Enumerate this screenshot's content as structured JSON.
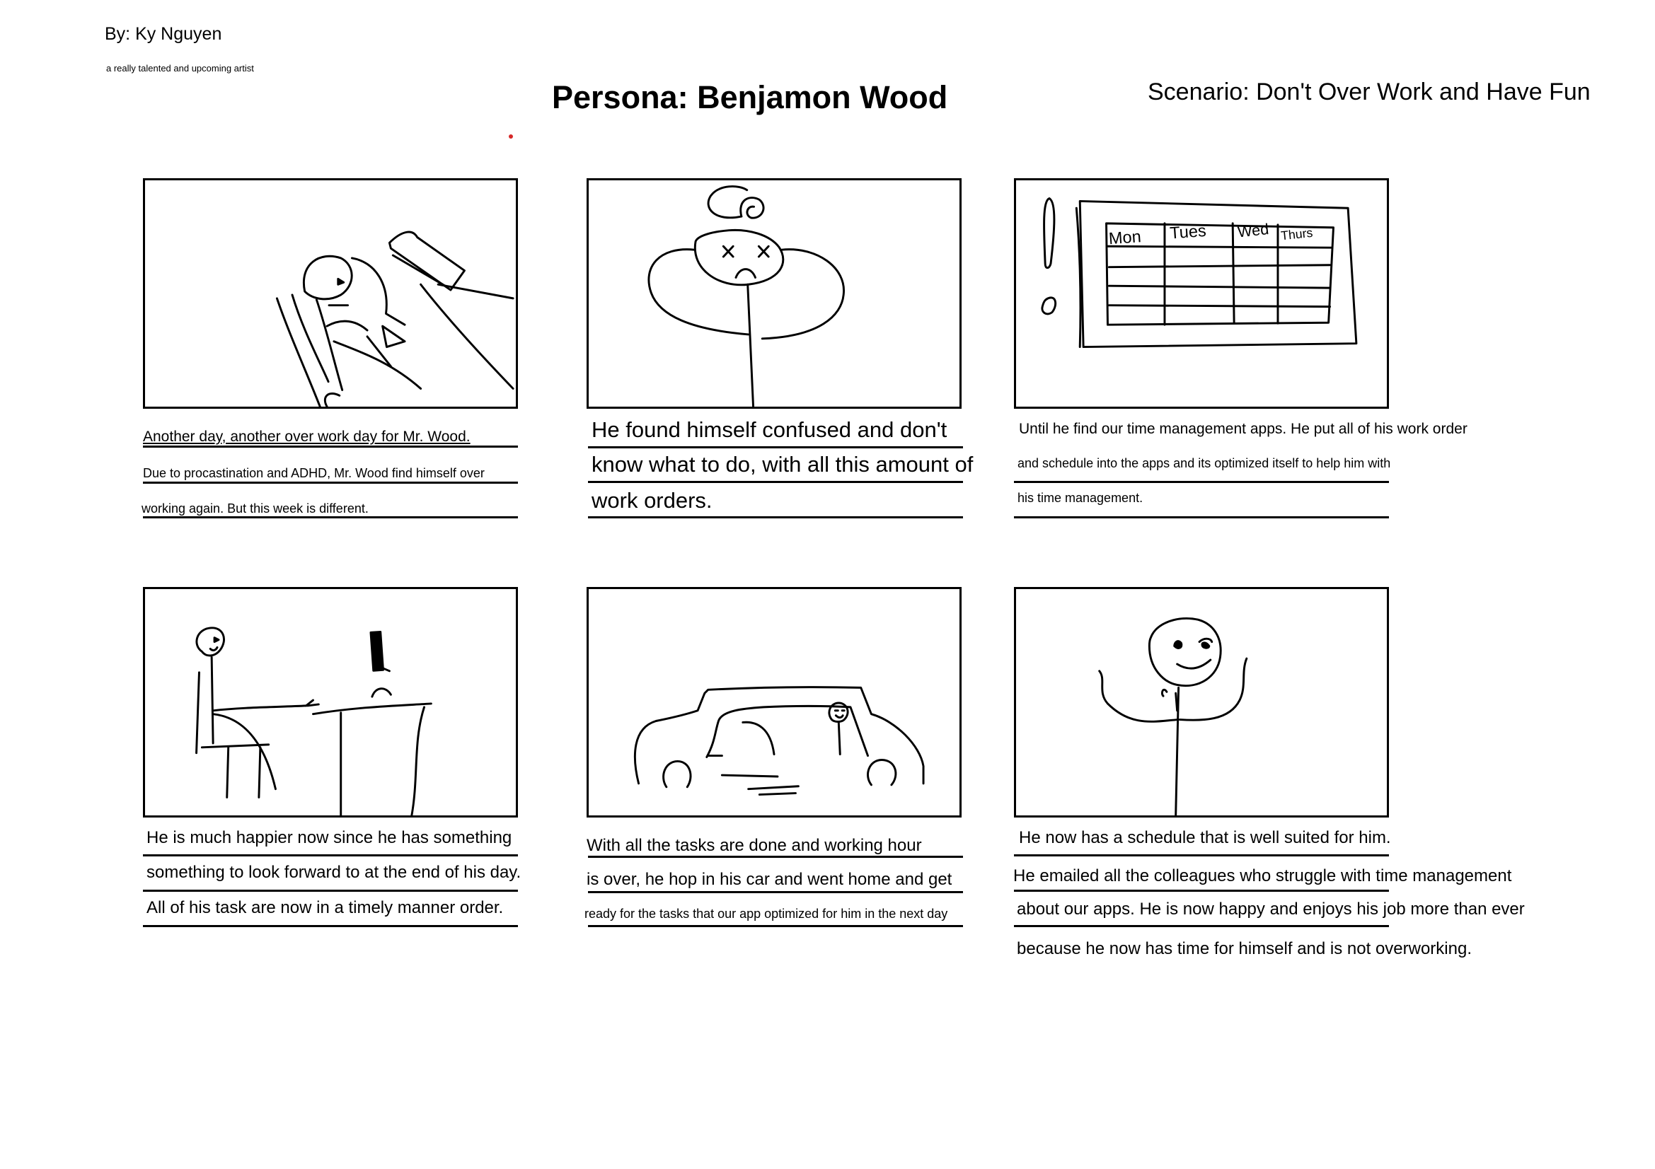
{
  "header": {
    "author": "By: Ky Nguyen",
    "tagline": "a really talented and upcoming artist",
    "persona": "Persona: Benjamon Wood",
    "scenario": "Scenario: Don't Over Work and Have Fun"
  },
  "panels": [
    {
      "drawing": "person-in-bed-illustration",
      "captions": [
        "Another day, another over work day for Mr. Wood.",
        "Due to procastination and ADHD, Mr. Wood find himself over",
        "working again. But this week is different."
      ]
    },
    {
      "drawing": "confused-face-illustration",
      "captions": [
        "He found himself confused and don't",
        "know what to do, with all this amount of",
        "work orders."
      ]
    },
    {
      "drawing": "weekly-calendar-illustration",
      "calendar_days": [
        "Mon",
        "Tues",
        "Wed",
        "Thurs"
      ],
      "captions": [
        "Until he find our time management apps. He put all of his work order",
        "and schedule into the apps and its optimized itself to help him with",
        "his time management."
      ]
    },
    {
      "drawing": "person-at-desk-illustration",
      "captions": [
        "He is much happier now since he has something",
        "something to look forward to at the end of his day.",
        "All of his task are now in a timely manner order."
      ]
    },
    {
      "drawing": "car-driving-home-illustration",
      "captions": [
        "With all the tasks are done and working hour",
        "is over, he hop in his car and went home and get",
        "ready for the tasks that our app optimized for him in the next day"
      ]
    },
    {
      "drawing": "happy-person-illustration",
      "captions": [
        "He now has a schedule that is well suited for him.",
        "He emailed all the colleagues who struggle with time management",
        "about our apps. He is now happy and enjoys his job more than ever",
        "because he now has time for himself and is not overworking."
      ]
    }
  ]
}
